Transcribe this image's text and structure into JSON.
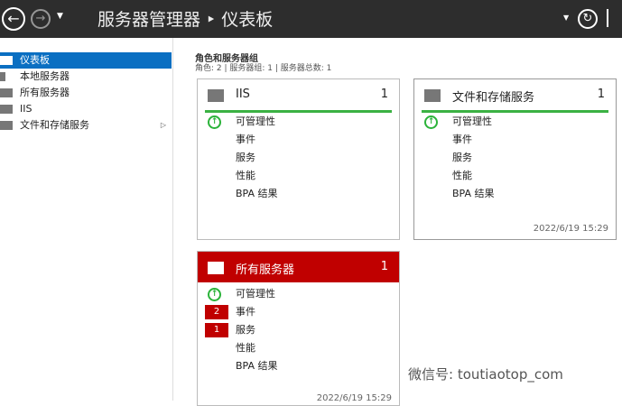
{
  "header": {
    "title": "服务器管理器 ‣ 仪表板"
  },
  "sidebar": {
    "items": [
      {
        "label": "仪表板"
      },
      {
        "label": "本地服务器"
      },
      {
        "label": "所有服务器"
      },
      {
        "label": "IIS"
      },
      {
        "label": "文件和存储服务"
      }
    ]
  },
  "main": {
    "section_title": "角色和服务器组",
    "section_sub": "角色: 2 | 服务器组: 1 | 服务器总数: 1"
  },
  "cards": [
    {
      "name": "IIS",
      "count": "1",
      "rows": [
        "可管理性",
        "事件",
        "服务",
        "性能",
        "BPA 结果"
      ],
      "date": ""
    },
    {
      "name": "文件和存储服务",
      "count": "1",
      "rows": [
        "可管理性",
        "事件",
        "服务",
        "性能",
        "BPA 结果"
      ],
      "date": "2022/6/19 15:29"
    },
    {
      "name": "所有服务器",
      "count": "1",
      "rows": [
        "可管理性",
        "事件",
        "服务",
        "性能",
        "BPA 结果"
      ],
      "badges": [
        "2",
        "1"
      ],
      "date": "2022/6/19 15:29"
    }
  ],
  "watermark": "微信号: toutiaotop_com"
}
